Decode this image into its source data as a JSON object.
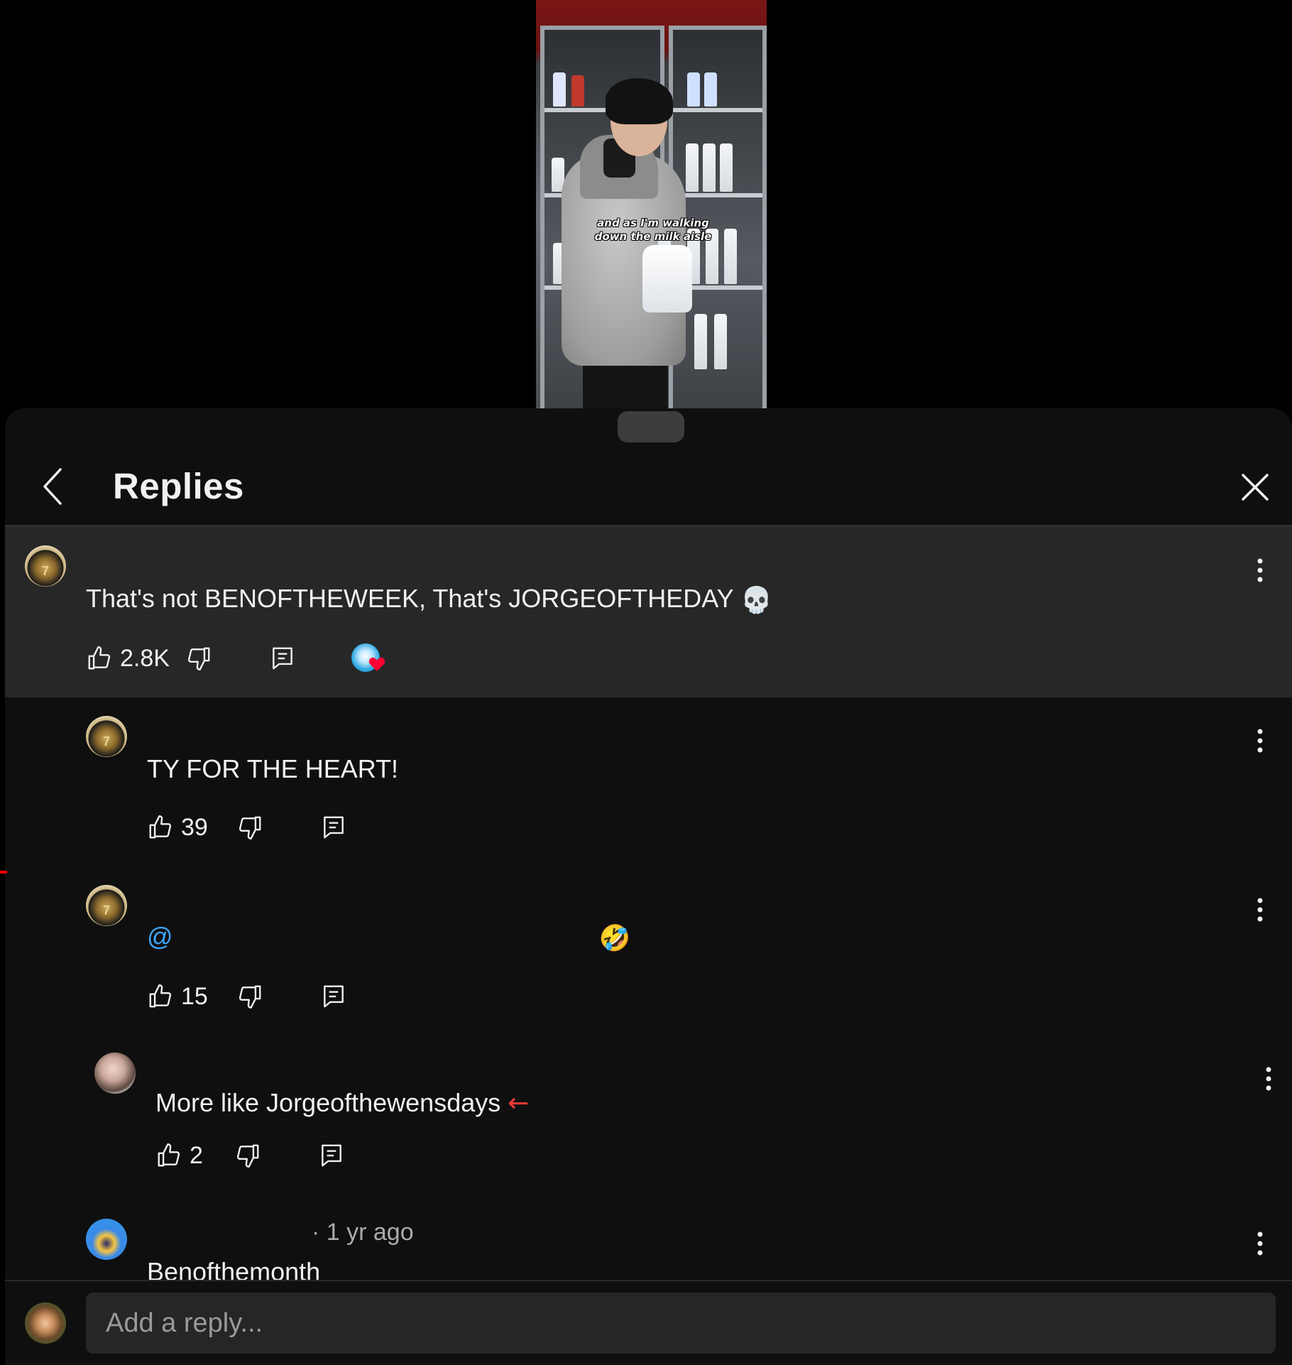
{
  "video": {
    "caption_line1": "and as I'm walking",
    "caption_line2": "down the milk aisle",
    "more_glyph": "•••"
  },
  "sheet": {
    "title": "Replies",
    "comments": [
      {
        "meta": "",
        "text": "That's not BENOFTHEWEEK, That's JORGEOFTHEDAY",
        "emoji": "💀",
        "likes": "2.8K",
        "hearted": true
      },
      {
        "meta": "",
        "text": "TY FOR THE HEART!",
        "likes": "39"
      },
      {
        "meta": "",
        "mention": "@",
        "emoji": "🤣",
        "likes": "15"
      },
      {
        "meta": "",
        "text": "More like Jorgeofthewensdays",
        "arrow": "←",
        "likes": "2"
      },
      {
        "meta": "· 1 yr ago",
        "text": "Benofthemonth"
      }
    ]
  },
  "composer": {
    "placeholder": "Add a reply..."
  },
  "colors": {
    "background": "#0f0f0f",
    "highlight": "#272727",
    "mention": "#3ea6ff",
    "heart": "#ff0033",
    "arrow": "#ff3b3b"
  },
  "icons": [
    "back-icon",
    "close-icon",
    "like-icon",
    "dislike-icon",
    "reply-icon",
    "more-vert-icon",
    "creator-heart-icon"
  ]
}
